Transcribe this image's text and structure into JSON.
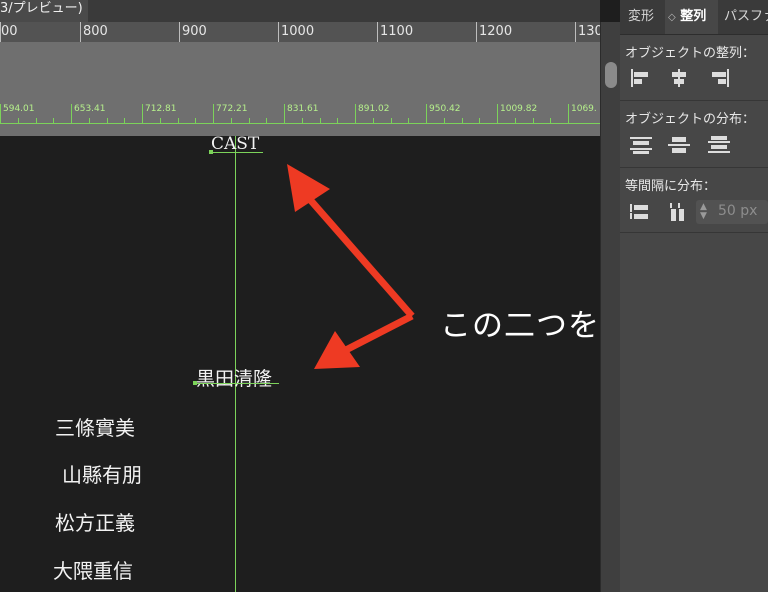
{
  "document_tab": {
    "label": "3/プレビュー)"
  },
  "ruler": {
    "labels": [
      "00",
      "800",
      "900",
      "1000",
      "1100",
      "1200",
      "130"
    ]
  },
  "smart_ruler": {
    "labels": [
      "594.01",
      "653.41",
      "712.81",
      "772.21",
      "831.61",
      "891.02",
      "950.42",
      "1009.82",
      "1069."
    ]
  },
  "canvas": {
    "cast_heading": "CAST",
    "selected_name": "黒田清隆",
    "names": [
      "三條實美",
      "山縣有朋",
      "松方正義",
      "大隈重信"
    ]
  },
  "annotation": {
    "text": "この二つを選択",
    "arrow_color": "#ee3a23"
  },
  "panel": {
    "tabs": [
      "変形",
      "整列",
      "パスファ"
    ],
    "tab_active_prefix": "◇",
    "align_section_title": "オブジェクトの整列：",
    "distribute_section_title": "オブジェクトの分布：",
    "spacing_section_title": "等間隔に分布：",
    "spacing_value": "50 px",
    "align_icons": [
      "align-left-icon",
      "align-horizontal-center-icon",
      "align-right-icon"
    ],
    "distribute_icons": [
      "distribute-top-icon",
      "distribute-vertical-center-icon",
      "distribute-bottom-icon"
    ],
    "spacing_icons": [
      "distribute-vertical-spacing-icon",
      "distribute-horizontal-spacing-icon"
    ]
  },
  "colors": {
    "guide": "#7cd35a",
    "artboard": "#1e1e1e",
    "panel": "#474747"
  }
}
